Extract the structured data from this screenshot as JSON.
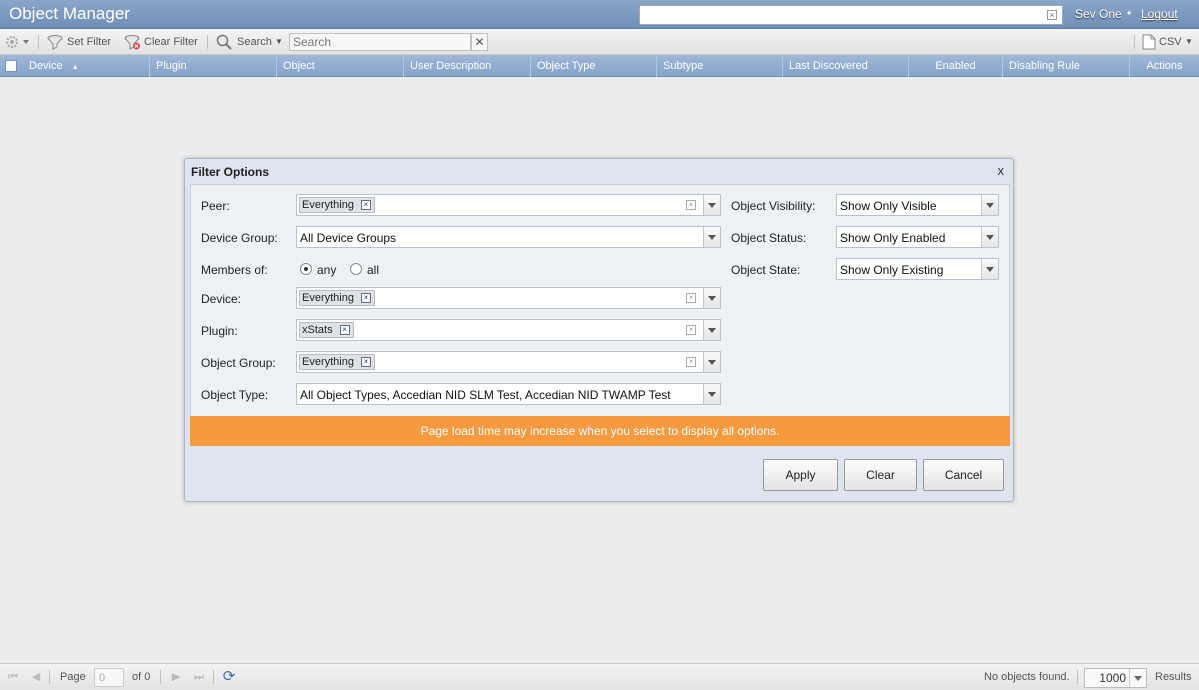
{
  "app": {
    "title": "Object Manager"
  },
  "topbar": {
    "user": "Sev One",
    "separator": "•",
    "logout": "Logout"
  },
  "toolbar": {
    "set_filter": "Set Filter",
    "clear_filter": "Clear Filter",
    "search_menu": "Search",
    "search_placeholder": "Search",
    "export": "CSV"
  },
  "grid": {
    "columns": [
      "Device",
      "Plugin",
      "Object",
      "User Description",
      "Object Type",
      "Subtype",
      "Last Discovered",
      "Enabled",
      "Disabling Rule",
      "Actions"
    ],
    "sort_indicator": "▲"
  },
  "dialog": {
    "title": "Filter Options",
    "close": "x",
    "peer": {
      "label": "Peer:",
      "tag": "Everything"
    },
    "device_group": {
      "label": "Device Group:",
      "value": "All Device Groups"
    },
    "members_of": {
      "label": "Members of:",
      "options": [
        "any",
        "all"
      ],
      "selected": "any"
    },
    "device": {
      "label": "Device:",
      "tag": "Everything"
    },
    "plugin": {
      "label": "Plugin:",
      "tag": "xStats"
    },
    "object_group": {
      "label": "Object Group:",
      "tag": "Everything"
    },
    "object_type": {
      "label": "Object Type:",
      "value": "All Object Types, Accedian NID SLM Test, Accedian NID TWAMP Test"
    },
    "object_visibility": {
      "label": "Object Visibility:",
      "value": "Show Only Visible"
    },
    "object_status": {
      "label": "Object Status:",
      "value": "Show Only Enabled"
    },
    "object_state": {
      "label": "Object State:",
      "value": "Show Only Existing"
    },
    "warning": "Page load time may increase when you select to display all options.",
    "buttons": {
      "apply": "Apply",
      "clear": "Clear",
      "cancel": "Cancel"
    }
  },
  "footer": {
    "page_label": "Page",
    "page_value": "0",
    "of_total": "of 0",
    "status": "No objects found.",
    "page_size": "1000",
    "results_label": "Results"
  }
}
